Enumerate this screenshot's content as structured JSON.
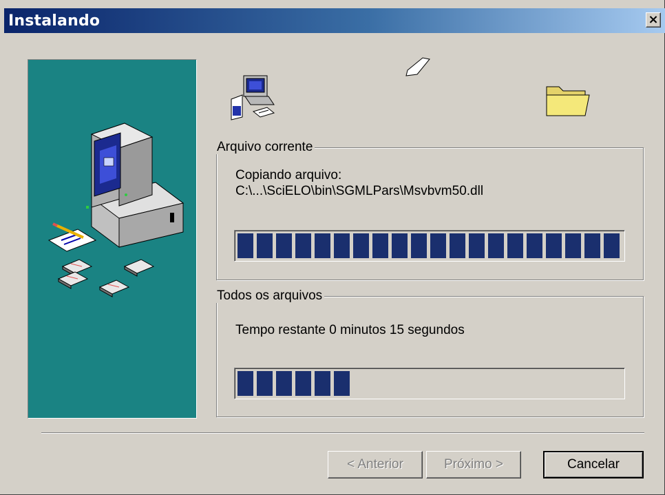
{
  "window": {
    "title": "Instalando",
    "close_glyph": "×"
  },
  "current_file": {
    "group_label": "Arquivo corrente",
    "status_text": "Copiando arquivo:",
    "file_path": "C:\\...\\SciELO\\bin\\SGMLPars\\Msvbvm50.dll",
    "progress_fraction": 1.0
  },
  "all_files": {
    "group_label": "Todos os arquivos",
    "time_remaining": "Tempo restante 0 minutos 15 segundos",
    "progress_fraction": 0.3
  },
  "icons": {
    "side_panel": "computer-with-floppy-disks-icon",
    "source": "computer-install-icon",
    "flying": "flying-document-icon",
    "destination": "folder-icon"
  },
  "buttons": {
    "back_label": "< Anterior",
    "next_label": "Próximo >",
    "cancel_label": "Cancelar"
  },
  "colors": {
    "titlebar_start": "#0a246a",
    "titlebar_end": "#a6caf0",
    "panel_teal": "#1a8383",
    "progress_block": "#1a2f6e",
    "dialog_face": "#d4d0c8"
  }
}
